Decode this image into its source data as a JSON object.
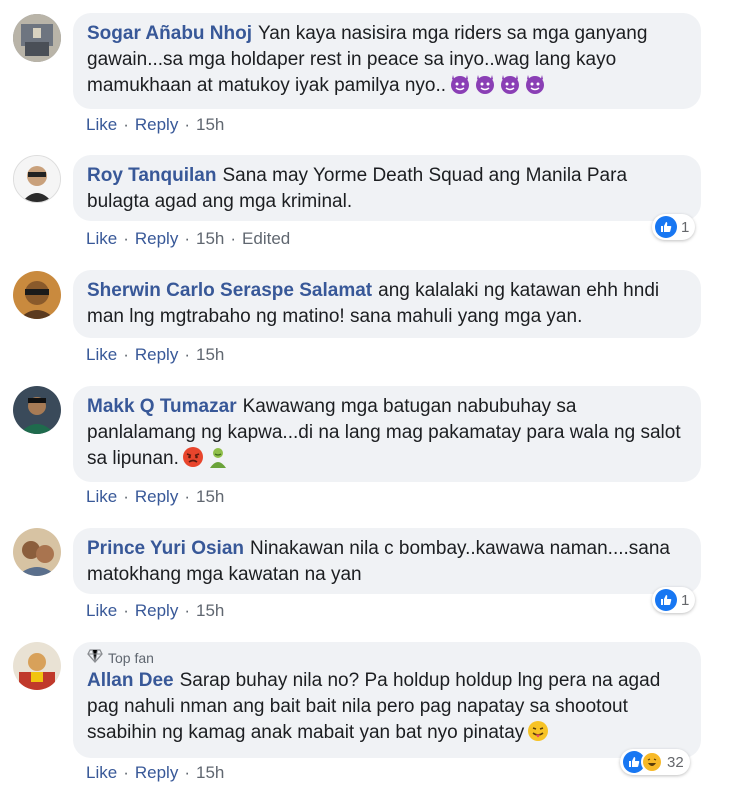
{
  "comments": [
    {
      "author": "Sogar Añabu Nhoj",
      "text": "Yan kaya nasisira mga riders sa mga ganyang gawain...sa mga holdaper rest in peace sa inyo..wag lang kayo mamukhaan at matukoy iyak pamilya nyo..",
      "emojis": [
        "devil-emoji",
        "devil-emoji",
        "devil-emoji",
        "devil-emoji"
      ],
      "like": "Like",
      "reply": "Reply",
      "time": "15h"
    },
    {
      "author": "Roy Tanquilan",
      "text": "Sana may Yorme Death Squad ang Manila Para bulagta agad ang mga kriminal.",
      "like": "Like",
      "reply": "Reply",
      "time": "15h",
      "edited": "Edited",
      "reaction_count": "1"
    },
    {
      "author": "Sherwin Carlo Seraspe Salamat",
      "text": "ang kalalaki ng katawan ehh hndi man lng mgtrabaho ng matino! sana mahuli yang mga yan.",
      "like": "Like",
      "reply": "Reply",
      "time": "15h"
    },
    {
      "author": "Makk Q Tumazar",
      "text": "Kawawang mga batugan nabubuhay sa panlalamang ng kapwa...di na lang mag pakamatay para wala ng salot sa lipunan.",
      "emojis": [
        "angry-face-emoji",
        "nauseated-person-emoji"
      ],
      "like": "Like",
      "reply": "Reply",
      "time": "15h"
    },
    {
      "author": "Prince Yuri Osian",
      "text": "Ninakawan nila c bombay..kawawa naman....sana matokhang mga kawatan na yan",
      "like": "Like",
      "reply": "Reply",
      "time": "15h",
      "reaction_count": "1"
    },
    {
      "badge": "Top fan",
      "author": "Allan Dee",
      "text": "Sarap buhay nila no? Pa holdup holdup lng pera na agad pag nahuli nman ang bait bait nila pero pag napatay sa shootout ssabihin ng kamag anak mabait yan bat nyo pinatay",
      "emojis": [
        "tongue-out-emoji"
      ],
      "like": "Like",
      "reply": "Reply",
      "time": "15h",
      "reaction_count": "32"
    }
  ],
  "colors": {
    "author": "#385898",
    "bubble": "#f0f2f5",
    "like_blue": "#1877f2",
    "meta": "#606770"
  }
}
